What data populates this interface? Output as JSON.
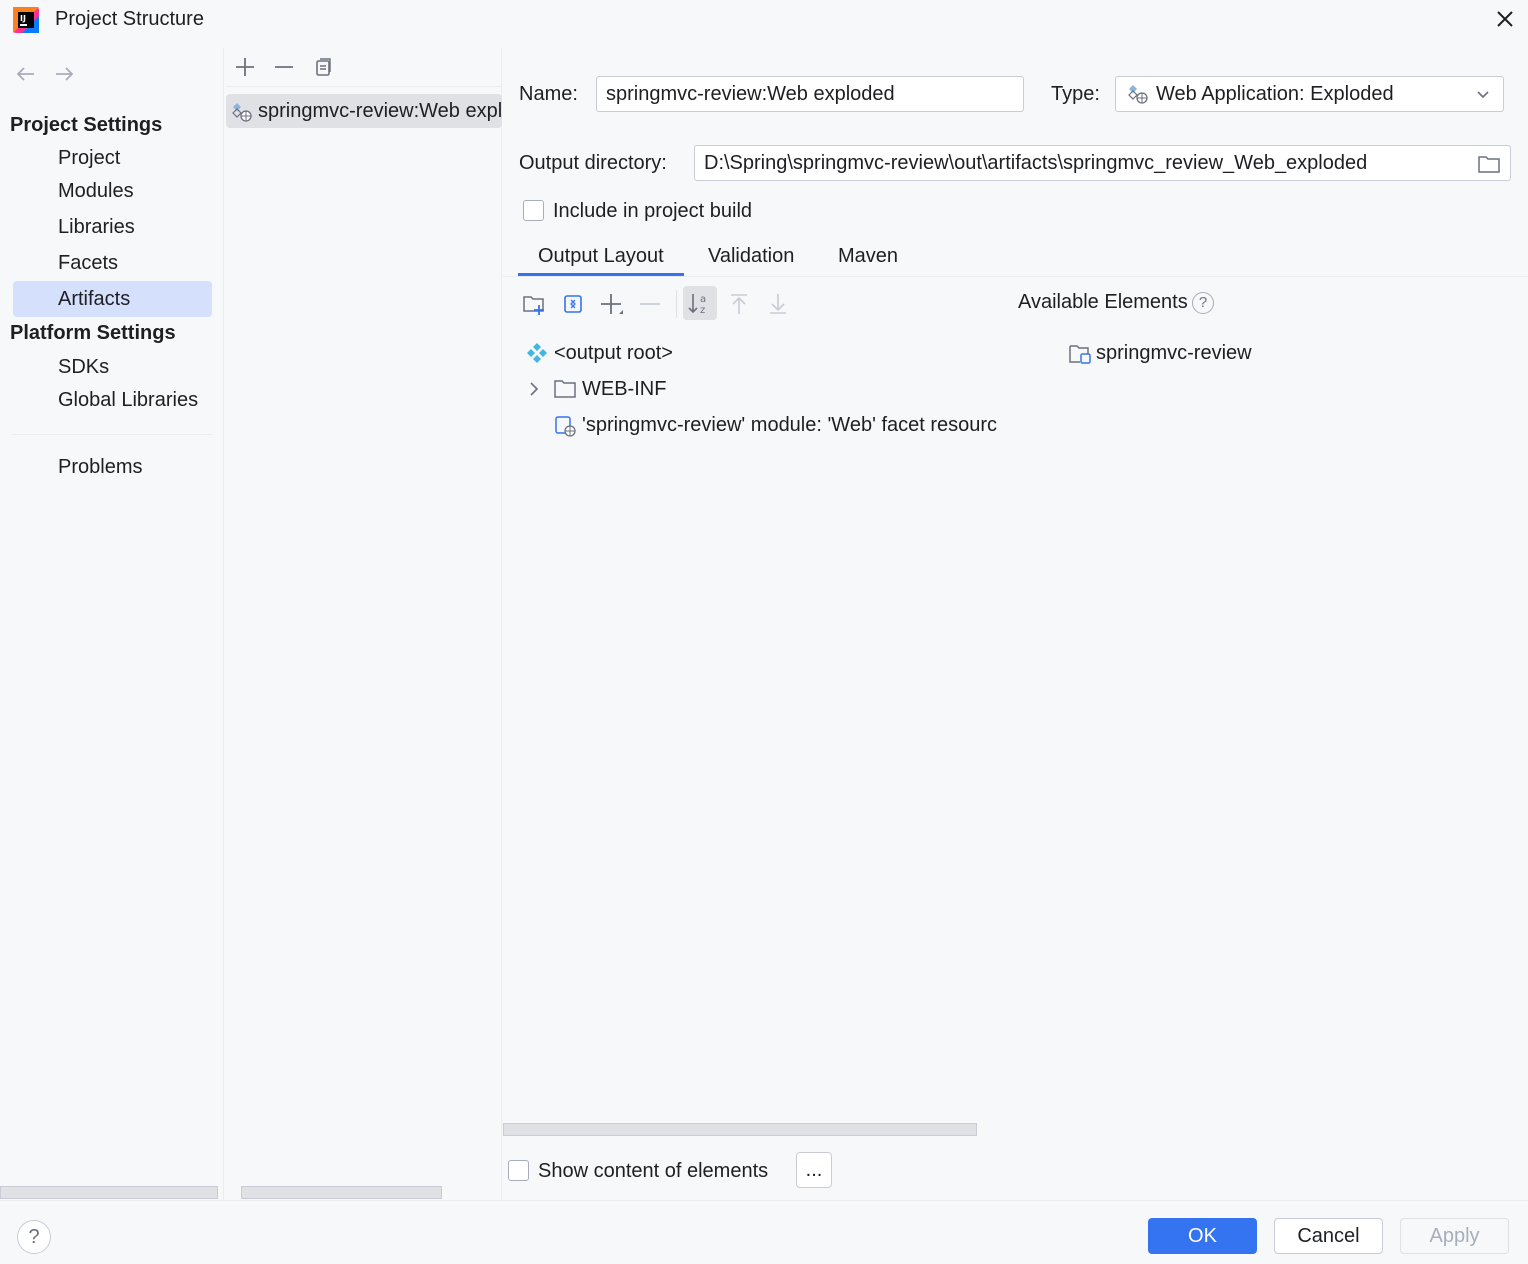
{
  "window": {
    "title": "Project Structure"
  },
  "nav": {
    "project_settings_header": "Project Settings",
    "project_items": [
      "Project",
      "Modules",
      "Libraries",
      "Facets",
      "Artifacts"
    ],
    "selected": "Artifacts",
    "platform_settings_header": "Platform Settings",
    "platform_items": [
      "SDKs",
      "Global Libraries"
    ],
    "problems": "Problems"
  },
  "artifacts": {
    "items": [
      "springmvc-review:Web exploded"
    ]
  },
  "form": {
    "name_label": "Name:",
    "name_value": "springmvc-review:Web exploded",
    "type_label": "Type:",
    "type_value": "Web Application: Exploded",
    "output_dir_label": "Output directory:",
    "output_dir_value": "D:\\Spring\\springmvc-review\\out\\artifacts\\springmvc_review_Web_exploded",
    "include_build_label": "Include in project build",
    "include_build_checked": false
  },
  "tabs": [
    "Output Layout",
    "Validation",
    "Maven"
  ],
  "active_tab": "Output Layout",
  "layout": {
    "tree": [
      "<output root>",
      "WEB-INF",
      "'springmvc-review' module: 'Web' facet resourc"
    ],
    "available_label": "Available Elements",
    "available_items": [
      "springmvc-review"
    ]
  },
  "bottom": {
    "show_content_label": "Show content of elements",
    "show_content_checked": false,
    "ellipsis": "..."
  },
  "buttons": {
    "ok": "OK",
    "cancel": "Cancel",
    "apply": "Apply",
    "help": "?"
  },
  "colors": {
    "accent": "#3574f0",
    "selection": "#d5e1fc",
    "background": "#f7f8fa"
  }
}
